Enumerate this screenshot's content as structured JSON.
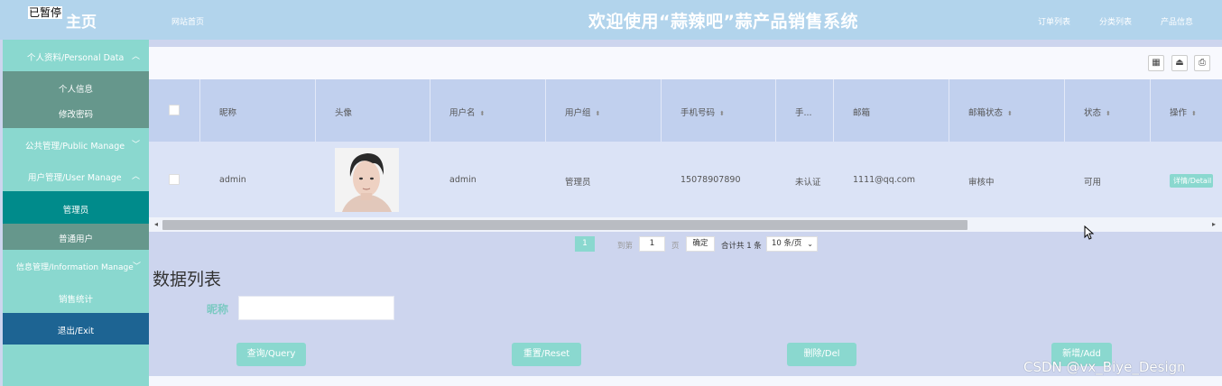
{
  "header": {
    "paused_badge": "已暂停",
    "home_title": "主页",
    "site_home": "网站首页",
    "system_title": "欢迎使用“蒜辣吧”蒜产品销售系统",
    "top_links": [
      "订单列表",
      "分类列表",
      "产品信息"
    ]
  },
  "sidebar": {
    "groups": [
      {
        "label": "个人资料/Personal Data",
        "chevron": "up-chevron-icon"
      },
      {
        "label": "公共管理/Public Manage",
        "chevron": "down-chevron-icon"
      },
      {
        "label": "用户管理/User Manage",
        "chevron": "up-chevron-icon"
      },
      {
        "label": "信息管理/Information Manage",
        "chevron": "down-chevron-icon"
      }
    ],
    "personal_items": [
      "个人信息",
      "修改密码"
    ],
    "user_items": [
      "管理员",
      "普通用户"
    ],
    "sales_stats": "销售统计",
    "exit": "退出/Exit",
    "colors": {
      "base": "#8ad8cf",
      "open_group": "#66978c",
      "active": "#008b8b",
      "exit": "#1d6493"
    }
  },
  "toolbar": {
    "icons": [
      "grid-icon",
      "export-icon",
      "print-icon"
    ]
  },
  "table": {
    "headers": [
      "昵称",
      "头像",
      "用户名",
      "用户组",
      "手机号码",
      "手...",
      "邮箱",
      "邮箱状态",
      "状态",
      "操作"
    ],
    "sortable": [
      false,
      false,
      true,
      true,
      true,
      false,
      false,
      true,
      true,
      true
    ],
    "rows": [
      {
        "nickname": "admin",
        "username": "admin",
        "group": "管理员",
        "phone": "15078907890",
        "phone_verified": "未认证",
        "email": "1111@qq.com",
        "email_status": "审核中",
        "status": "可用",
        "action": "详情/Detail"
      }
    ]
  },
  "pagination": {
    "current_page": "1",
    "goto_label": "到第",
    "goto_value": "1",
    "page_unit": "页",
    "confirm": "确定",
    "total": "合计共 1 条",
    "page_size": "10 条/页"
  },
  "list": {
    "title": "数据列表",
    "filter_label": "昵称",
    "filter_value": "",
    "buttons": [
      "查询/Query",
      "重置/Reset",
      "删除/Del",
      "新增/Add"
    ]
  },
  "watermark": "CSDN @vx_Biye_Design"
}
